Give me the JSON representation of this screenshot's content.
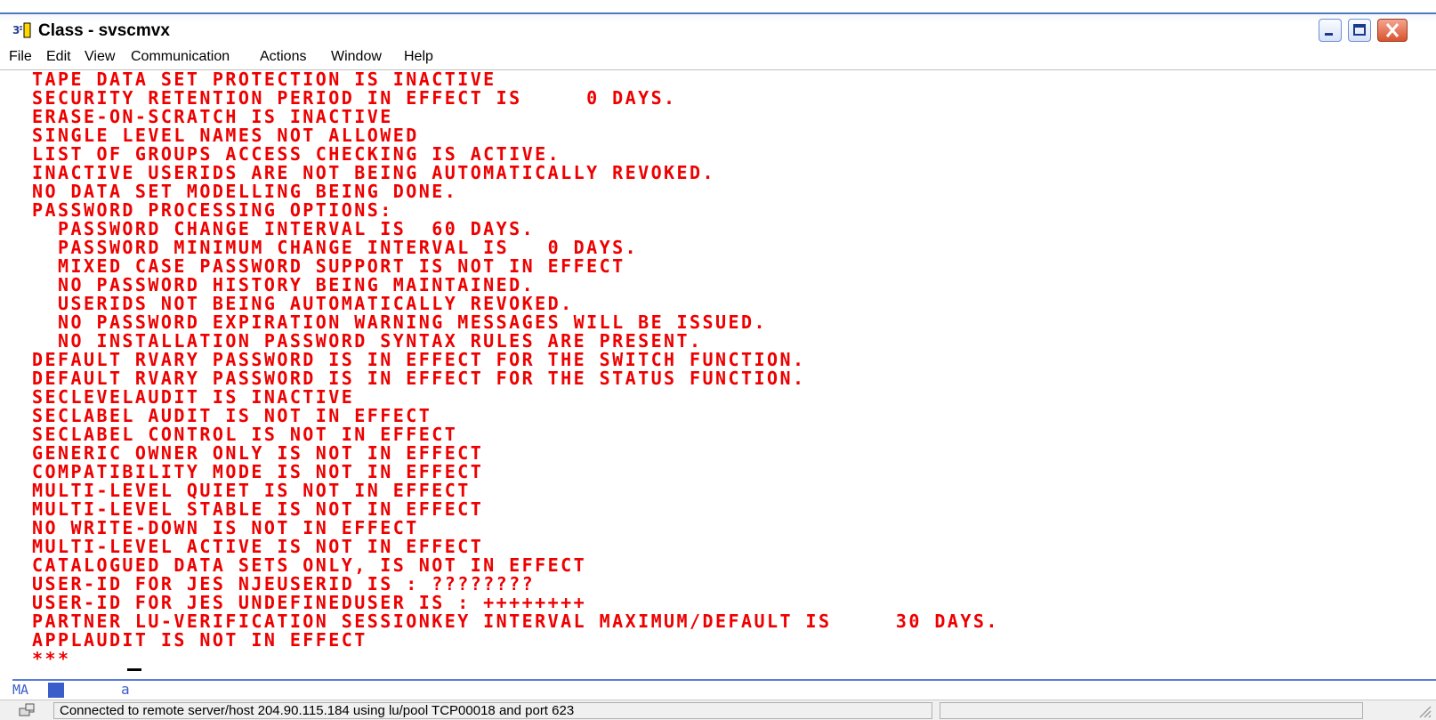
{
  "window": {
    "title": "Class - svscmvx"
  },
  "menu": [
    "File",
    "Edit",
    "View",
    "Communication",
    "Actions",
    "Window",
    "Help"
  ],
  "terminal": {
    "text_color": "#ee0000",
    "lines": [
      "TAPE DATA SET PROTECTION IS INACTIVE",
      "SECURITY RETENTION PERIOD IN EFFECT IS     0 DAYS.",
      "ERASE-ON-SCRATCH IS INACTIVE",
      "SINGLE LEVEL NAMES NOT ALLOWED",
      "LIST OF GROUPS ACCESS CHECKING IS ACTIVE.",
      "INACTIVE USERIDS ARE NOT BEING AUTOMATICALLY REVOKED.",
      "NO DATA SET MODELLING BEING DONE.",
      "PASSWORD PROCESSING OPTIONS:",
      "  PASSWORD CHANGE INTERVAL IS  60 DAYS.",
      "  PASSWORD MINIMUM CHANGE INTERVAL IS   0 DAYS.",
      "  MIXED CASE PASSWORD SUPPORT IS NOT IN EFFECT",
      "  NO PASSWORD HISTORY BEING MAINTAINED.",
      "  USERIDS NOT BEING AUTOMATICALLY REVOKED.",
      "  NO PASSWORD EXPIRATION WARNING MESSAGES WILL BE ISSUED.",
      "  NO INSTALLATION PASSWORD SYNTAX RULES ARE PRESENT.",
      "DEFAULT RVARY PASSWORD IS IN EFFECT FOR THE SWITCH FUNCTION.",
      "DEFAULT RVARY PASSWORD IS IN EFFECT FOR THE STATUS FUNCTION.",
      "SECLEVELAUDIT IS INACTIVE",
      "SECLABEL AUDIT IS NOT IN EFFECT",
      "SECLABEL CONTROL IS NOT IN EFFECT",
      "GENERIC OWNER ONLY IS NOT IN EFFECT",
      "COMPATIBILITY MODE IS NOT IN EFFECT",
      "MULTI-LEVEL QUIET IS NOT IN EFFECT",
      "MULTI-LEVEL STABLE IS NOT IN EFFECT",
      "NO WRITE-DOWN IS NOT IN EFFECT",
      "MULTI-LEVEL ACTIVE IS NOT IN EFFECT",
      "CATALOGUED DATA SETS ONLY, IS NOT IN EFFECT",
      "USER-ID FOR JES NJEUSERID IS : ????????",
      "USER-ID FOR JES UNDEFINEDUSER IS : ++++++++",
      "PARTNER LU-VERIFICATION SESSIONKEY INTERVAL MAXIMUM/DEFAULT IS     30 DAYS.",
      "APPLAUDIT IS NOT IN EFFECT",
      "***"
    ]
  },
  "oia": {
    "mode": "MA",
    "indicator": "a"
  },
  "status": {
    "message": "Connected to remote server/host 204.90.115.184 using lu/pool TCP00018 and port 623"
  }
}
